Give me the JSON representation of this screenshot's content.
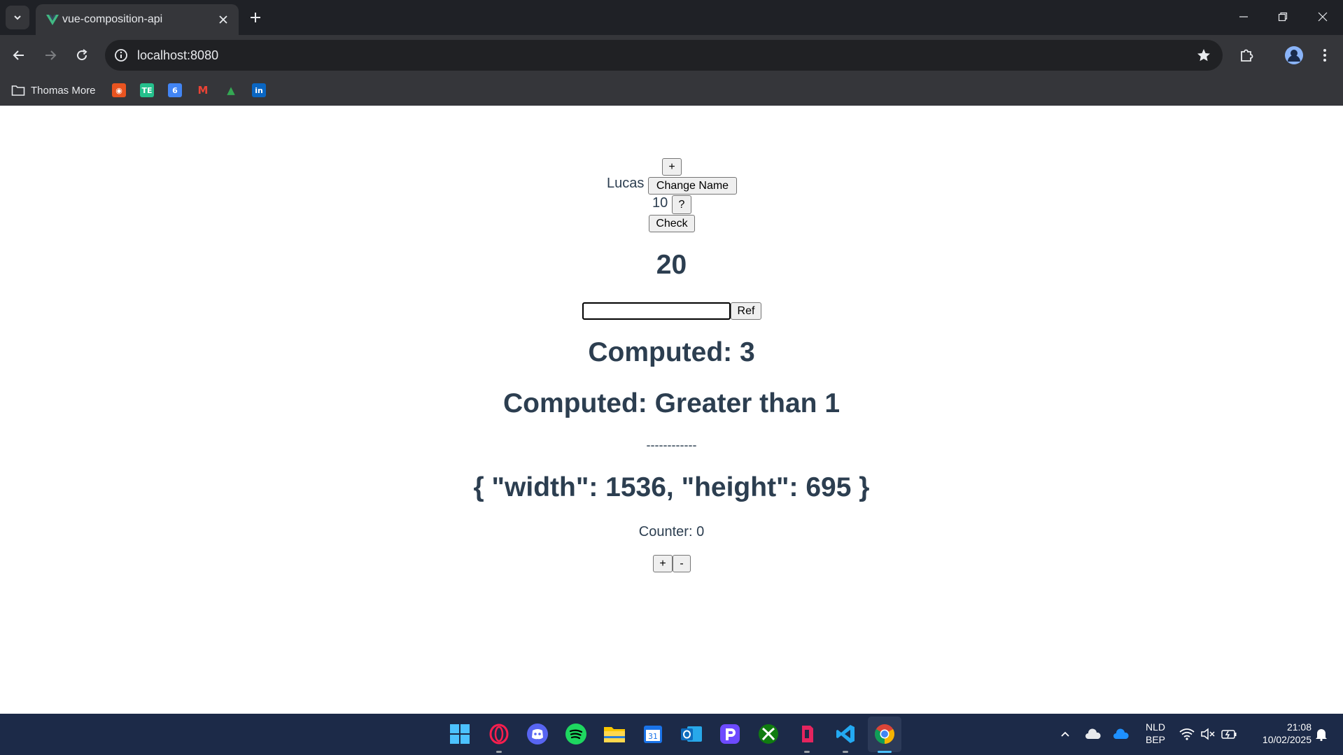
{
  "browser": {
    "tab_title": "vue-composition-api",
    "url": "localhost:8080",
    "bookmarks": {
      "folder_label": "Thomas More",
      "items": [
        {
          "name": "ubuntu-bookmark",
          "glyph": "◉",
          "color": "#e95420"
        },
        {
          "name": "te-bookmark",
          "glyph": "TE",
          "color": "#25c08c"
        },
        {
          "name": "calendar-bookmark",
          "glyph": "6",
          "color": "#4285f4"
        },
        {
          "name": "gmail-bookmark",
          "glyph": "M",
          "color": "#ea4335"
        },
        {
          "name": "drive-bookmark",
          "glyph": "▲",
          "color": "#34a853"
        },
        {
          "name": "linkedin-bookmark",
          "glyph": "in",
          "color": "#0a66c2"
        }
      ]
    }
  },
  "app": {
    "plus_button": "+",
    "name": "Lucas",
    "change_name_button": "Change Name",
    "number": "10",
    "question_button": "?",
    "check_button": "Check",
    "big_number": "20",
    "ref_input_value": "",
    "ref_button": "Ref",
    "computed_count": "Computed: 3",
    "computed_text": "Computed: Greater than 1",
    "separator": "------------",
    "window_size": "{ \"width\": 1536, \"height\": 695 }",
    "counter": "Counter: 0",
    "counter_plus": "+",
    "counter_minus": "-"
  },
  "taskbar": {
    "language_line1": "NLD",
    "language_line2": "BEP",
    "time": "21:08",
    "date": "10/02/2025"
  }
}
